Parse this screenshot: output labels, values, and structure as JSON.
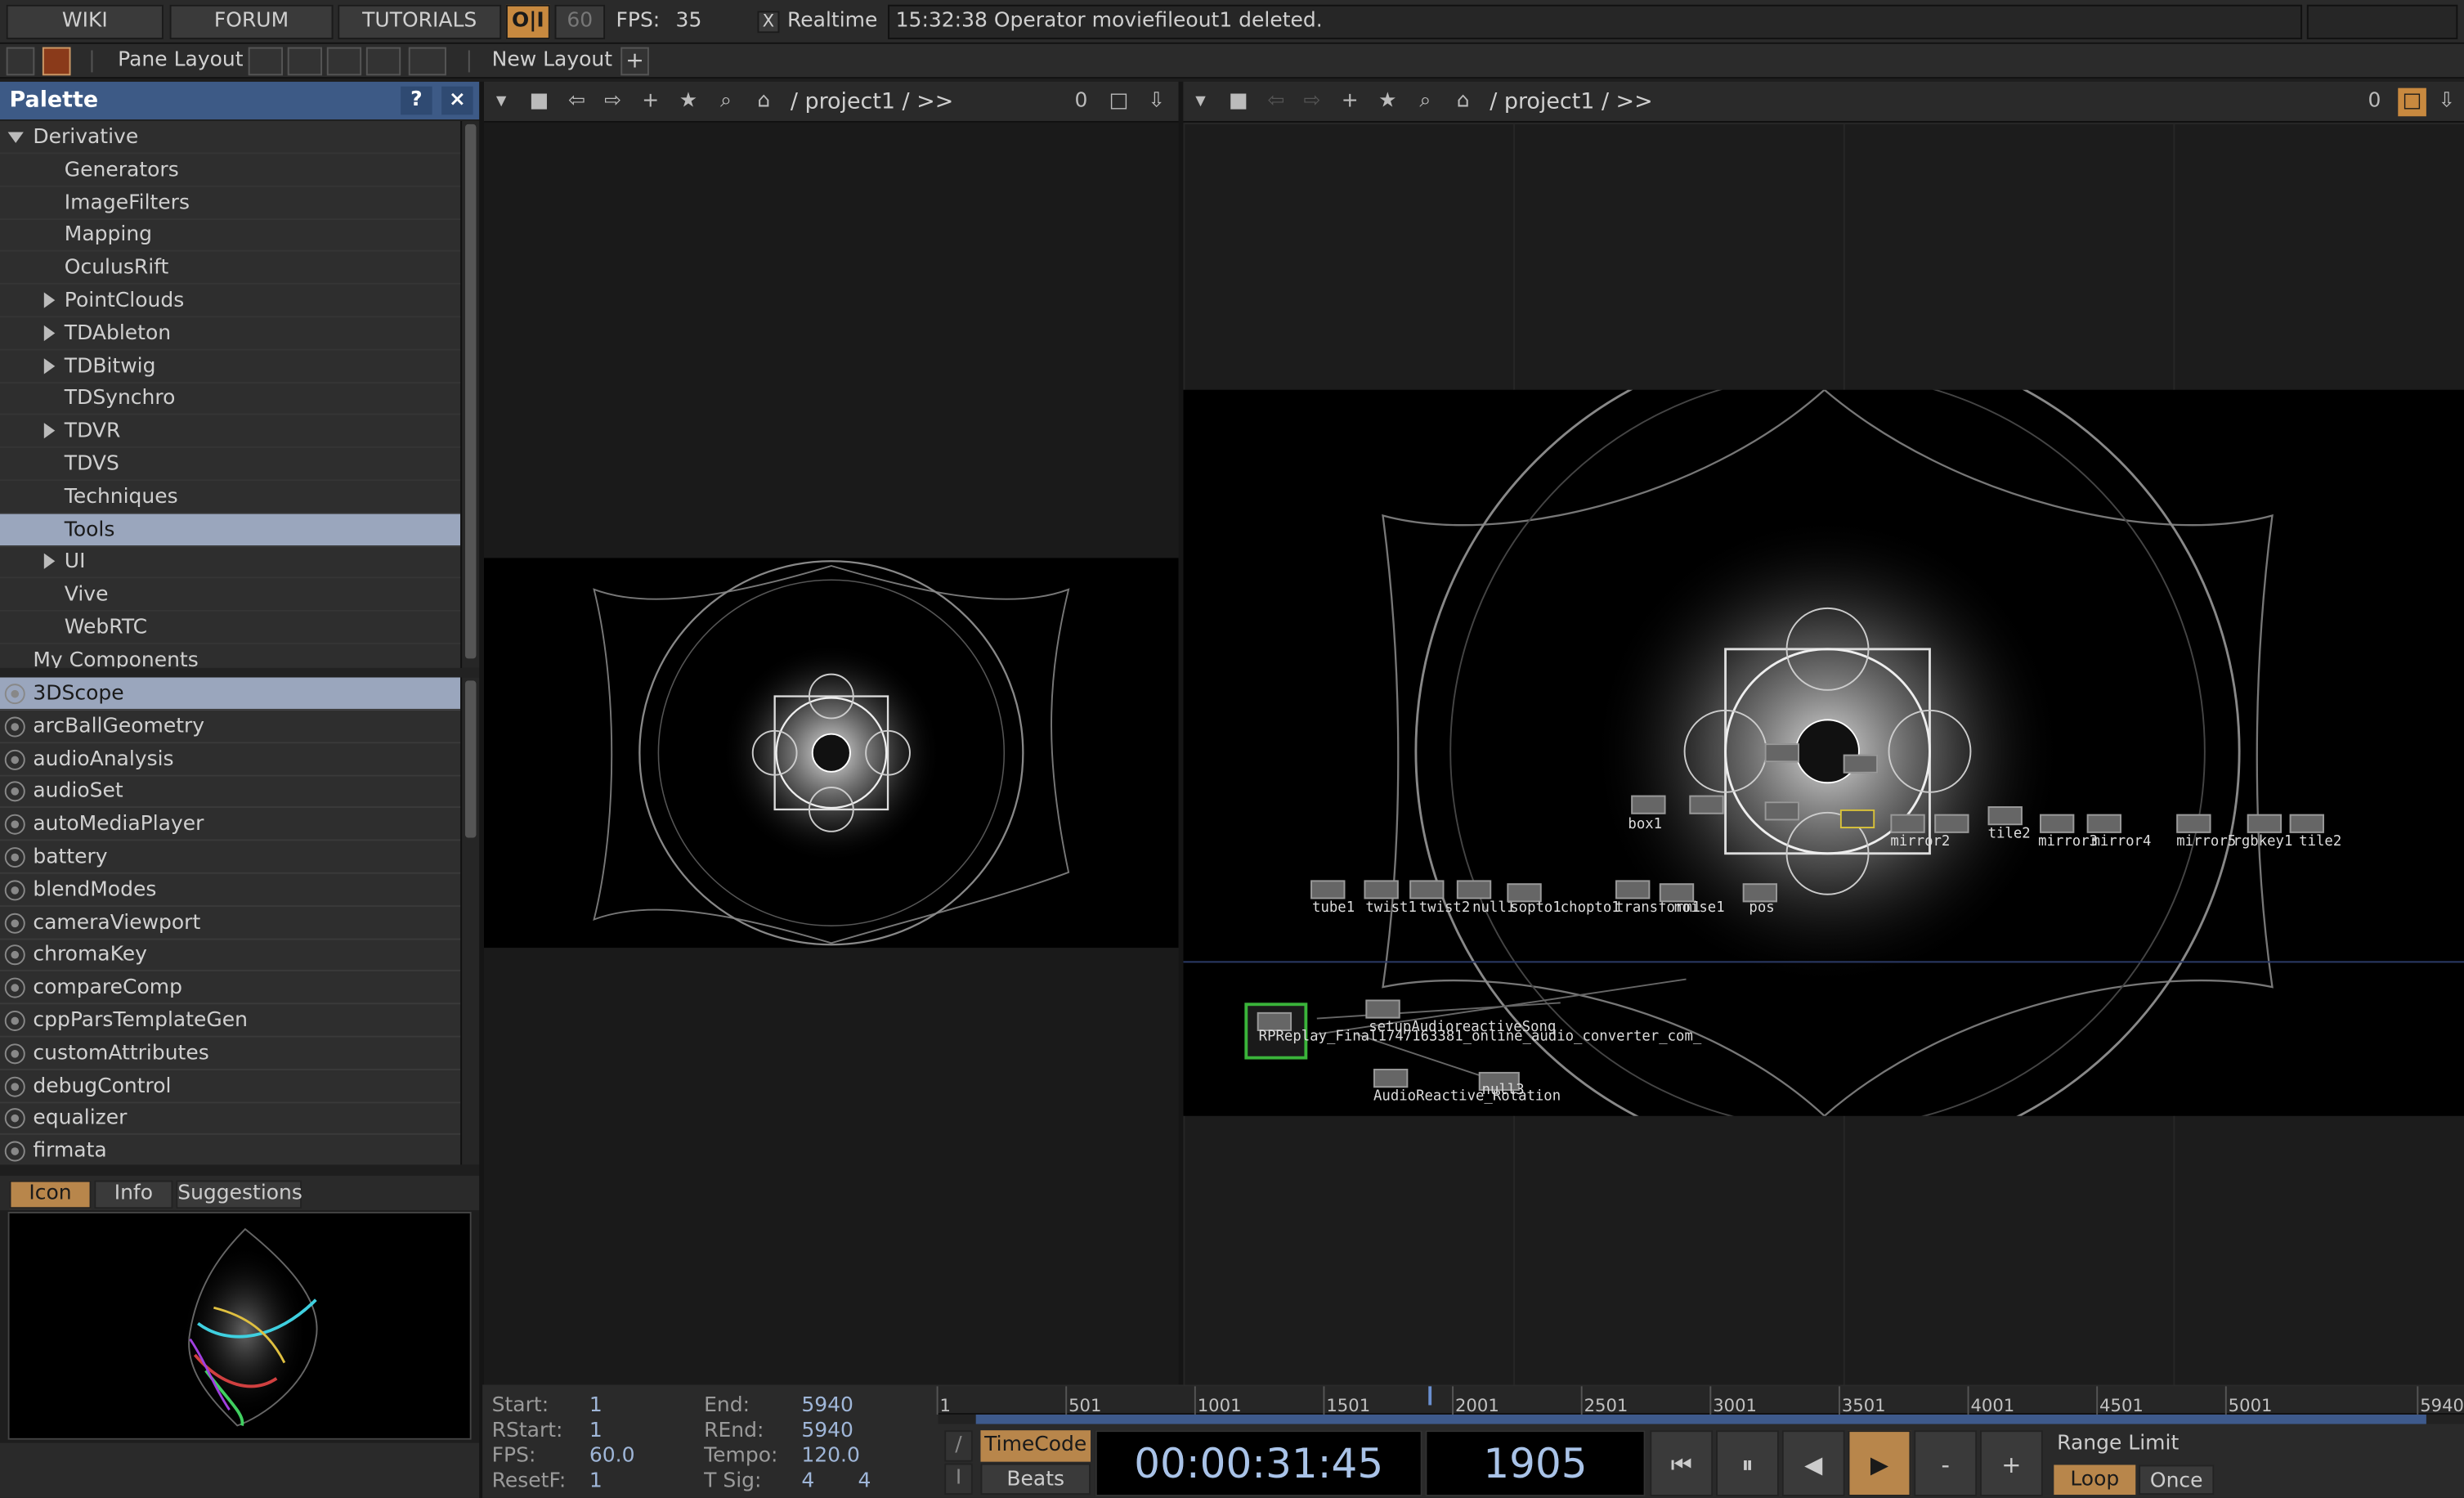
{
  "topbar": {
    "wiki": "WIKI",
    "forum": "FORUM",
    "tutorials": "TUTORIALS",
    "oi": "O|I",
    "sixty": "60",
    "fps_label": "FPS:",
    "fps_value": "35",
    "realtime_label": "Realtime",
    "realtime_check": "X",
    "status_message": "15:32:38 Operator moviefileout1 deleted."
  },
  "layoutbar": {
    "pane_layout": "Pane Layout",
    "new_layout": "New Layout",
    "add": "+"
  },
  "palette": {
    "title": "Palette",
    "help": "?",
    "close": "×",
    "tree": [
      {
        "label": "Derivative",
        "indent": 0,
        "arrow": "down"
      },
      {
        "label": "Generators",
        "indent": 1,
        "arrow": "none"
      },
      {
        "label": "ImageFilters",
        "indent": 1,
        "arrow": "none"
      },
      {
        "label": "Mapping",
        "indent": 1,
        "arrow": "none"
      },
      {
        "label": "OculusRift",
        "indent": 1,
        "arrow": "none"
      },
      {
        "label": "PointClouds",
        "indent": 1,
        "arrow": "right"
      },
      {
        "label": "TDAbleton",
        "indent": 1,
        "arrow": "right"
      },
      {
        "label": "TDBitwig",
        "indent": 1,
        "arrow": "right"
      },
      {
        "label": "TDSynchro",
        "indent": 1,
        "arrow": "none"
      },
      {
        "label": "TDVR",
        "indent": 1,
        "arrow": "right"
      },
      {
        "label": "TDVS",
        "indent": 1,
        "arrow": "none"
      },
      {
        "label": "Techniques",
        "indent": 1,
        "arrow": "none"
      },
      {
        "label": "Tools",
        "indent": 1,
        "arrow": "none",
        "selected": true
      },
      {
        "label": "UI",
        "indent": 1,
        "arrow": "right"
      },
      {
        "label": "Vive",
        "indent": 1,
        "arrow": "none"
      },
      {
        "label": "WebRTC",
        "indent": 1,
        "arrow": "none"
      },
      {
        "label": "My Components",
        "indent": 0,
        "arrow": "none"
      }
    ],
    "components": [
      {
        "label": "3DScope",
        "selected": true
      },
      {
        "label": "arcBallGeometry"
      },
      {
        "label": "audioAnalysis"
      },
      {
        "label": "audioSet"
      },
      {
        "label": "autoMediaPlayer"
      },
      {
        "label": "battery"
      },
      {
        "label": "blendModes"
      },
      {
        "label": "cameraViewport"
      },
      {
        "label": "chromaKey"
      },
      {
        "label": "compareComp"
      },
      {
        "label": "cppParsTemplateGen"
      },
      {
        "label": "customAttributes"
      },
      {
        "label": "debugControl"
      },
      {
        "label": "equalizer"
      },
      {
        "label": "firmata"
      }
    ],
    "tabs": {
      "icon": "Icon",
      "info": "Info",
      "suggestions": "Suggestions"
    }
  },
  "pane_left": {
    "path": "/ project1 / >>",
    "counter": "0"
  },
  "pane_right": {
    "path": "/ project1 / >>",
    "counter": "0"
  },
  "network_labels": {
    "box1": "box1",
    "tube": "tube1",
    "twist1": "twist1",
    "twist2": "twist2",
    "null": "null1",
    "sopto": "sopto1",
    "chopto": "chopto1",
    "transform": "transform1",
    "noise": "noise1",
    "pos": "pos",
    "mirror": "mirror2",
    "mirror3": "mirror3",
    "mirror4": "mirror4",
    "mirror5": "mirror5",
    "rgbkey": "rgbkey1",
    "tile": "tile2",
    "tile2": "tile2",
    "setup": "setupAudioreactiveSong",
    "replay": "RPReplay_Final1747163381_online_audio_converter_com_",
    "rotation": "AudioReactive_Rotation",
    "null3": "null3"
  },
  "timeline": {
    "start_label": "Start:",
    "start": "1",
    "end_label": "End:",
    "end": "5940",
    "rstart_label": "RStart:",
    "rstart": "1",
    "rend_label": "REnd:",
    "rend": "5940",
    "fps_label": "FPS:",
    "fps": "60.0",
    "tempo_label": "Tempo:",
    "tempo": "120.0",
    "resetf_label": "ResetF:",
    "resetf": "1",
    "tsig_label": "T Sig:",
    "tsig_a": "4",
    "tsig_b": "4",
    "ticks": [
      "1",
      "501",
      "1001",
      "1501",
      "2001",
      "2501",
      "3001",
      "3501",
      "4001",
      "4501",
      "5001",
      "5940"
    ],
    "timecode_btn": "TimeCode",
    "beats_btn": "Beats",
    "slash": "/",
    "i_btn": "I",
    "timecode": "00:00:31:45",
    "frame": "1905",
    "minus": "-",
    "plus": "+",
    "range_limit": "Range Limit",
    "loop": "Loop",
    "once": "Once"
  },
  "colors": {
    "accent": "#b8864b",
    "selection": "#9aa6bd",
    "palette_header": "#3d5a86",
    "timecode_text": "#a9c3e8"
  }
}
